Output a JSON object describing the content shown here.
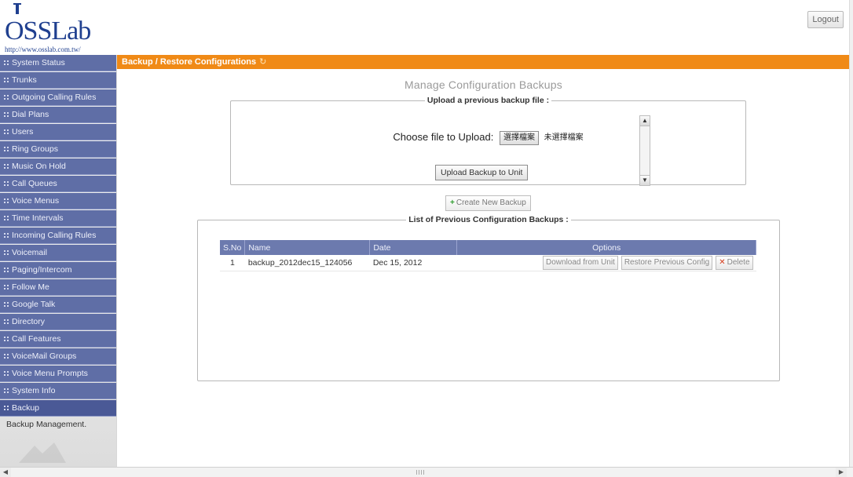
{
  "header": {
    "logo_text": "OSSLab",
    "logo_url": "http://www.osslab.com.tw/",
    "logout_label": "Logout"
  },
  "sidebar": {
    "items": [
      {
        "label": "System Status"
      },
      {
        "label": "Trunks"
      },
      {
        "label": "Outgoing Calling Rules"
      },
      {
        "label": "Dial Plans"
      },
      {
        "label": "Users"
      },
      {
        "label": "Ring Groups"
      },
      {
        "label": "Music On Hold"
      },
      {
        "label": "Call Queues"
      },
      {
        "label": "Voice Menus"
      },
      {
        "label": "Time Intervals"
      },
      {
        "label": "Incoming Calling Rules"
      },
      {
        "label": "Voicemail"
      },
      {
        "label": "Paging/Intercom"
      },
      {
        "label": "Follow Me"
      },
      {
        "label": "Google Talk"
      },
      {
        "label": "Directory"
      },
      {
        "label": "Call Features"
      },
      {
        "label": "VoiceMail Groups"
      },
      {
        "label": "Voice Menu Prompts"
      },
      {
        "label": "System Info"
      },
      {
        "label": "Backup"
      }
    ],
    "description": "Backup Management."
  },
  "page": {
    "title": "Backup / Restore Configurations",
    "heading": "Manage Configuration Backups"
  },
  "upload": {
    "legend": "Upload a previous backup file :",
    "choose_label": "Choose file to Upload:",
    "choose_button": "選擇檔案",
    "no_file_text": "未選擇檔案",
    "upload_button": "Upload Backup to Unit"
  },
  "create_button": "Create New Backup",
  "backups": {
    "legend": "List of Previous Configuration Backups :",
    "columns": [
      "S.No",
      "Name",
      "Date",
      "Options"
    ],
    "rows": [
      {
        "sno": "1",
        "name": "backup_2012dec15_124056",
        "date": "Dec 15, 2012"
      }
    ],
    "download_label": "Download from Unit",
    "restore_label": "Restore Previous Config",
    "delete_label": "Delete"
  },
  "colors": {
    "accent_orange": "#f08a16",
    "nav_blue": "#5f6ea6",
    "table_header": "#6c7aae"
  }
}
